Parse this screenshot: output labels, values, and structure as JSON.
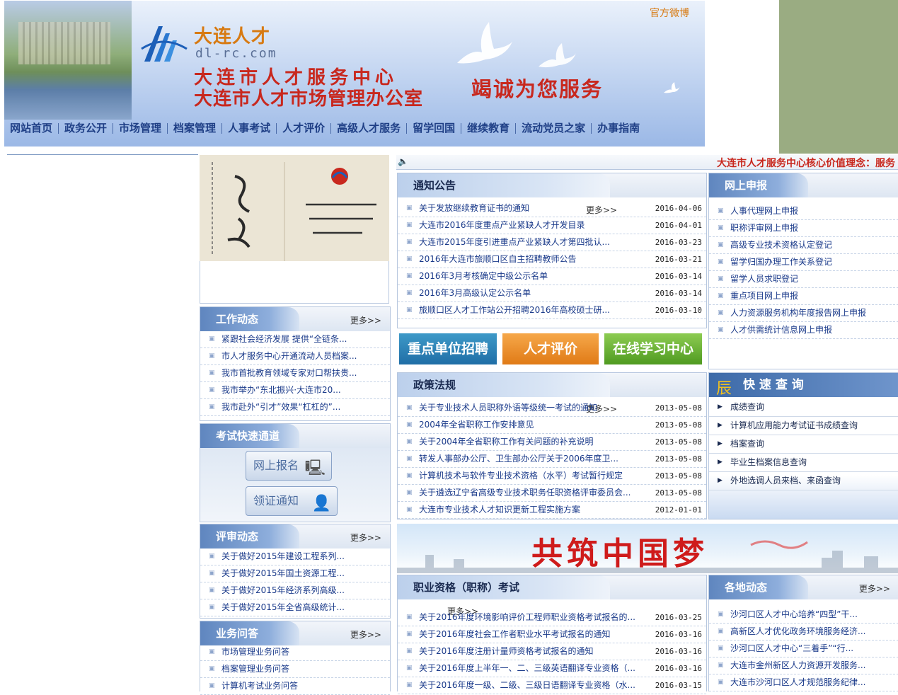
{
  "header": {
    "brand": "大连人才",
    "domain": "dl-rc.com",
    "org_line1": "大连市人才服务中心",
    "org_line2": "大连市人才市场管理办公室",
    "slogan": "竭诚为您服务",
    "weibo": "官方微博"
  },
  "nav": [
    "网站首页",
    "政务公开",
    "市场管理",
    "档案管理",
    "人事考试",
    "人才评价",
    "高级人才服务",
    "留学回国",
    "继续教育",
    "流动党员之家",
    "办事指南"
  ],
  "ticker": "大连市人才服务中心核心价值理念：服务",
  "more_label": "更多>>",
  "notice": {
    "title": "通知公告",
    "items": [
      {
        "text": "关于发放继续教育证书的通知",
        "date": "2016-04-06"
      },
      {
        "text": "大连市2016年度重点产业紧缺人才开发目录",
        "date": "2016-04-01"
      },
      {
        "text": "大连市2015年度引进重点产业紧缺人才第四批认...",
        "date": "2016-03-23"
      },
      {
        "text": "2016年大连市旅顺口区自主招聘教师公告",
        "date": "2016-03-21"
      },
      {
        "text": "2016年3月考核确定中级公示名单",
        "date": "2016-03-14"
      },
      {
        "text": "2016年3月高级认定公示名单",
        "date": "2016-03-14"
      },
      {
        "text": "旅顺口区人才工作站公开招聘2016年高校硕士研...",
        "date": "2016-03-10"
      }
    ]
  },
  "banners": [
    "重点单位招聘",
    "人才评价",
    "在线学习中心"
  ],
  "policy": {
    "title": "政策法规",
    "items": [
      {
        "text": "关于专业技术人员职称外语等级统一考试的通知",
        "date": "2013-05-08"
      },
      {
        "text": "2004年全省职称工作安排意见",
        "date": "2013-05-08"
      },
      {
        "text": "关于2004年全省职称工作有关问题的补充说明",
        "date": "2013-05-08"
      },
      {
        "text": "转发人事部办公厅、卫生部办公厅关于2006年度卫...",
        "date": "2013-05-08"
      },
      {
        "text": "计算机技术与软件专业技术资格（水平）考试暂行规定",
        "date": "2013-05-08"
      },
      {
        "text": "关于遴选辽宁省高级专业技术职务任职资格评审委员会...",
        "date": "2013-05-08"
      },
      {
        "text": "大连市专业技术人才知识更新工程实施方案",
        "date": "2012-01-01"
      }
    ]
  },
  "dream_text": "共筑中国梦",
  "exam": {
    "title": "职业资格（职称）考试",
    "items": [
      {
        "text": "关于2016年度环境影响评价工程师职业资格考试报名的...",
        "date": "2016-03-25"
      },
      {
        "text": "关于2016年度社会工作者职业水平考试报名的通知",
        "date": "2016-03-16"
      },
      {
        "text": "关于2016年度注册计量师资格考试报名的通知",
        "date": "2016-03-16"
      },
      {
        "text": "关于2016年度上半年一、二、三级英语翻译专业资格（...",
        "date": "2016-03-16"
      },
      {
        "text": "关于2016年度一级、二级、三级日语翻译专业资格（水...",
        "date": "2016-03-15"
      }
    ]
  },
  "work": {
    "title": "工作动态",
    "items": [
      "紧跟社会经济发展 提供“全链条...",
      "市人才服务中心开通流动人员档案...",
      "我市首批教育领域专家对口帮扶贵...",
      "我市举办“东北振兴·大连市20...",
      "我市赴外“引才”效果“杠杠的”..."
    ]
  },
  "exam_channel": {
    "title": "考试快速通道",
    "buttons": [
      "网上报名",
      "领证通知"
    ]
  },
  "review": {
    "title": "评审动态",
    "items": [
      "关于做好2015年建设工程系列...",
      "关于做好2015年国土资源工程...",
      "关于做好2015年经济系列高级...",
      "关于做好2015年全省高级统计..."
    ]
  },
  "qa": {
    "title": "业务问答",
    "items": [
      "市场管理业务问答",
      "档案管理业务问答",
      "计算机考试业务问答"
    ]
  },
  "online": {
    "title": "网上申报",
    "items": [
      "人事代理网上申报",
      "职称评审网上申报",
      "高级专业技术资格认定登记",
      "留学归国办理工作关系登记",
      "留学人员求职登记",
      "重点项目网上申报",
      "人力资源服务机构年度报告网上申报",
      "人才供需统计信息网上申报"
    ]
  },
  "quick": {
    "title": "快 速 查 询",
    "items": [
      "成绩查询",
      "计算机应用能力考试证书成绩查询",
      "档案查询",
      "毕业生档案信息查询",
      "外地选调人员来档、来函查询"
    ]
  },
  "local": {
    "title": "各地动态",
    "items": [
      "沙河口区人才中心培养“四型”干...",
      "高新区人才优化政务环境服务经济...",
      "沙河口区人才中心“三着手”“行...",
      "大连市金州新区人力资源开发服务...",
      "大连市沙河口区人才规范服务纪律..."
    ]
  }
}
